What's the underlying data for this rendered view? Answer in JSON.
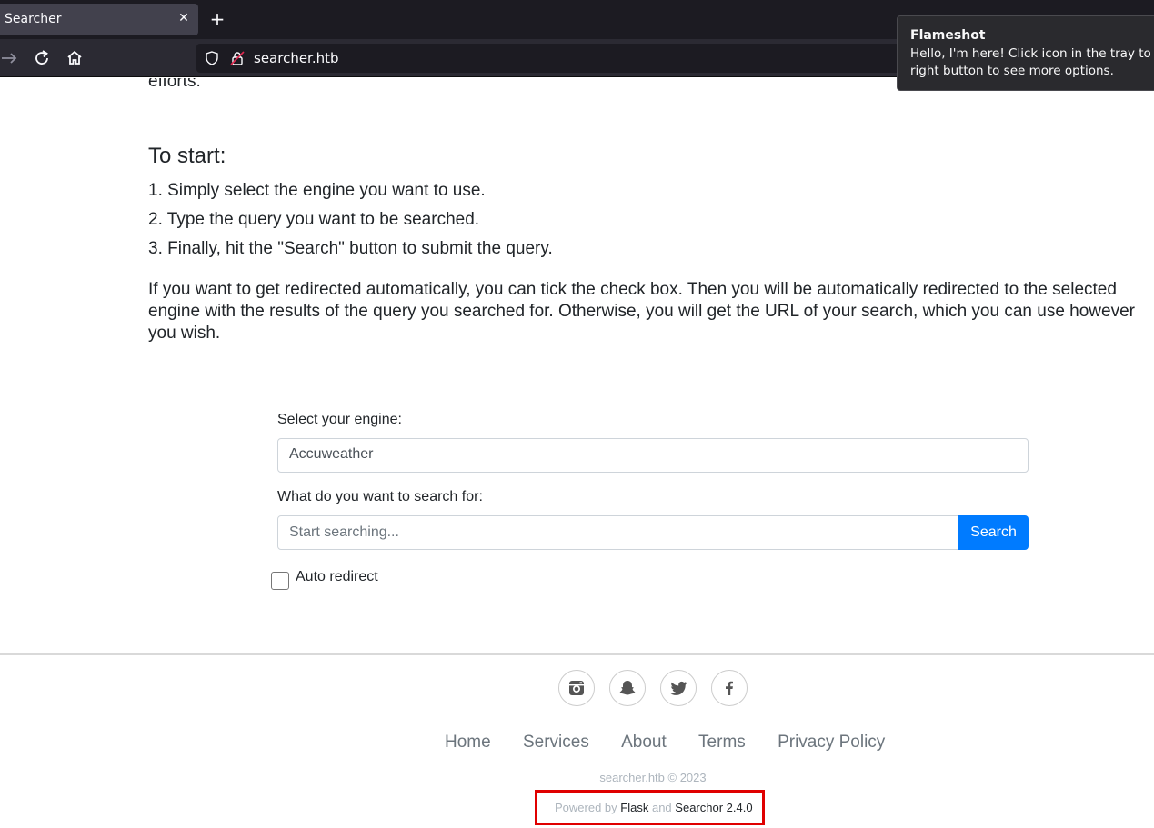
{
  "browser": {
    "tab_title": "Searcher",
    "tab_close": "✕",
    "new_tab": "+",
    "url": "searcher.htb"
  },
  "notification": {
    "title": "Flameshot",
    "line1": "Hello, I'm here! Click icon in the tray to tak",
    "line2": "right button to see more options."
  },
  "page": {
    "partial_text": "efforts.",
    "start_heading": "To start:",
    "steps": [
      "1. Simply select the engine you want to use.",
      "2. Type the query you want to be searched.",
      "3. Finally, hit the \"Search\" button to submit the query."
    ],
    "paragraph": "If you want to get redirected automatically, you can tick the check box. Then you will be automatically redirected to the selected engine with the results of the query you searched for. Otherwise, you will get the URL of your search, which you can use however you wish."
  },
  "form": {
    "engine_label": "Select your engine:",
    "engine_value": "Accuweather",
    "query_label": "What do you want to search for:",
    "query_placeholder": "Start searching...",
    "search_button": "Search",
    "auto_redirect_label": "Auto redirect",
    "auto_redirect_checked": false
  },
  "footer": {
    "social_icons": [
      "instagram-icon",
      "snapchat-icon",
      "twitter-icon",
      "facebook-icon"
    ],
    "links": [
      "Home",
      "Services",
      "About",
      "Terms",
      "Privacy Policy"
    ],
    "copyright": "searcher.htb © 2023",
    "powered_prefix": "Powered by",
    "powered_flask": "Flask",
    "powered_and": "and",
    "powered_searchor": "Searchor 2.4.0",
    "highlight_color": "#e00000"
  },
  "colors": {
    "primary": "#007bff",
    "browser_dark": "#1c1b22"
  }
}
